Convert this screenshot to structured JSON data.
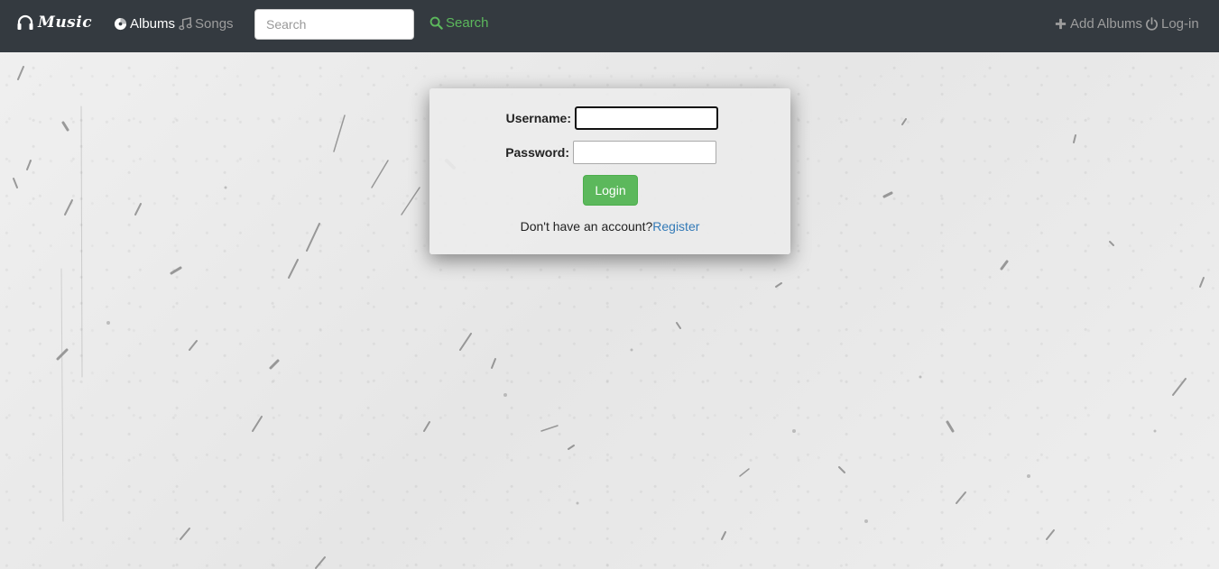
{
  "navbar": {
    "brand": "Music",
    "brand_icon": "headphones-icon",
    "albums_label": "Albums",
    "albums_icon": "disc-icon",
    "songs_label": "Songs",
    "songs_icon": "music-note-icon",
    "search_placeholder": "Search",
    "search_button_label": "Search",
    "search_icon": "search-icon",
    "add_albums_label": "Add Albums",
    "add_icon": "plus-icon",
    "login_label": "Log-in",
    "power_icon": "power-icon",
    "colors": {
      "background": "#343a40",
      "active": "#ffffff",
      "inactive": "#9d9d9d",
      "search_accent": "#5cb85c"
    }
  },
  "login_form": {
    "username_label": "Username:",
    "username_value": "",
    "password_label": "Password:",
    "password_value": "",
    "submit_label": "Login",
    "no_account_text": "Don't have an account?",
    "register_link": "Register",
    "colors": {
      "submit": "#5cb85c",
      "link": "#337ab7"
    }
  }
}
